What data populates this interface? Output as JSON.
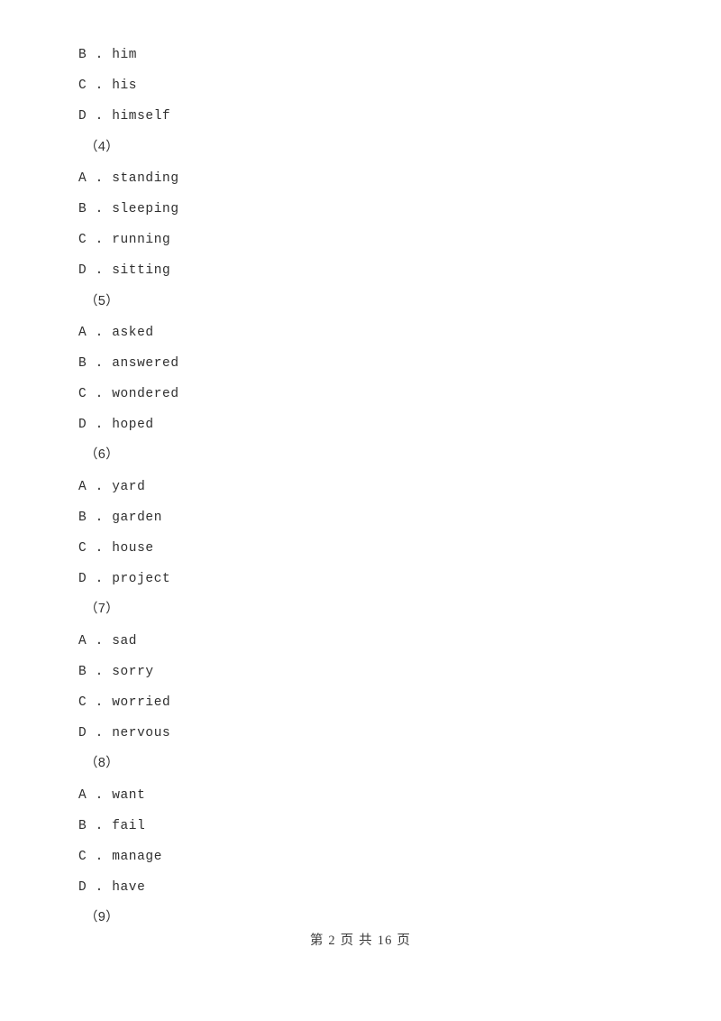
{
  "document": {
    "page_label": "第 2 页 共 16 页",
    "page_number": "2",
    "total_pages": "16",
    "text_color": "#2f2f2f",
    "background_color": "#ffffff"
  },
  "lines": [
    {
      "kind": "option",
      "text": "B . him"
    },
    {
      "kind": "option",
      "text": "C . his"
    },
    {
      "kind": "option",
      "text": "D . himself"
    },
    {
      "kind": "qnum",
      "text": "（4）"
    },
    {
      "kind": "option",
      "text": "A . standing"
    },
    {
      "kind": "option",
      "text": "B . sleeping"
    },
    {
      "kind": "option",
      "text": "C . running"
    },
    {
      "kind": "option",
      "text": "D . sitting"
    },
    {
      "kind": "qnum",
      "text": "（5）"
    },
    {
      "kind": "option",
      "text": "A . asked"
    },
    {
      "kind": "option",
      "text": "B . answered"
    },
    {
      "kind": "option",
      "text": "C . wondered"
    },
    {
      "kind": "option",
      "text": "D . hoped"
    },
    {
      "kind": "qnum",
      "text": "（6）"
    },
    {
      "kind": "option",
      "text": "A . yard"
    },
    {
      "kind": "option",
      "text": "B . garden"
    },
    {
      "kind": "option",
      "text": "C . house"
    },
    {
      "kind": "option",
      "text": "D . project"
    },
    {
      "kind": "qnum",
      "text": "（7）"
    },
    {
      "kind": "option",
      "text": "A . sad"
    },
    {
      "kind": "option",
      "text": "B . sorry"
    },
    {
      "kind": "option",
      "text": "C . worried"
    },
    {
      "kind": "option",
      "text": "D . nervous"
    },
    {
      "kind": "qnum",
      "text": "（8）"
    },
    {
      "kind": "option",
      "text": "A . want"
    },
    {
      "kind": "option",
      "text": "B . fail"
    },
    {
      "kind": "option",
      "text": "C . manage"
    },
    {
      "kind": "option",
      "text": "D . have"
    },
    {
      "kind": "qnum",
      "text": "（9）"
    }
  ]
}
